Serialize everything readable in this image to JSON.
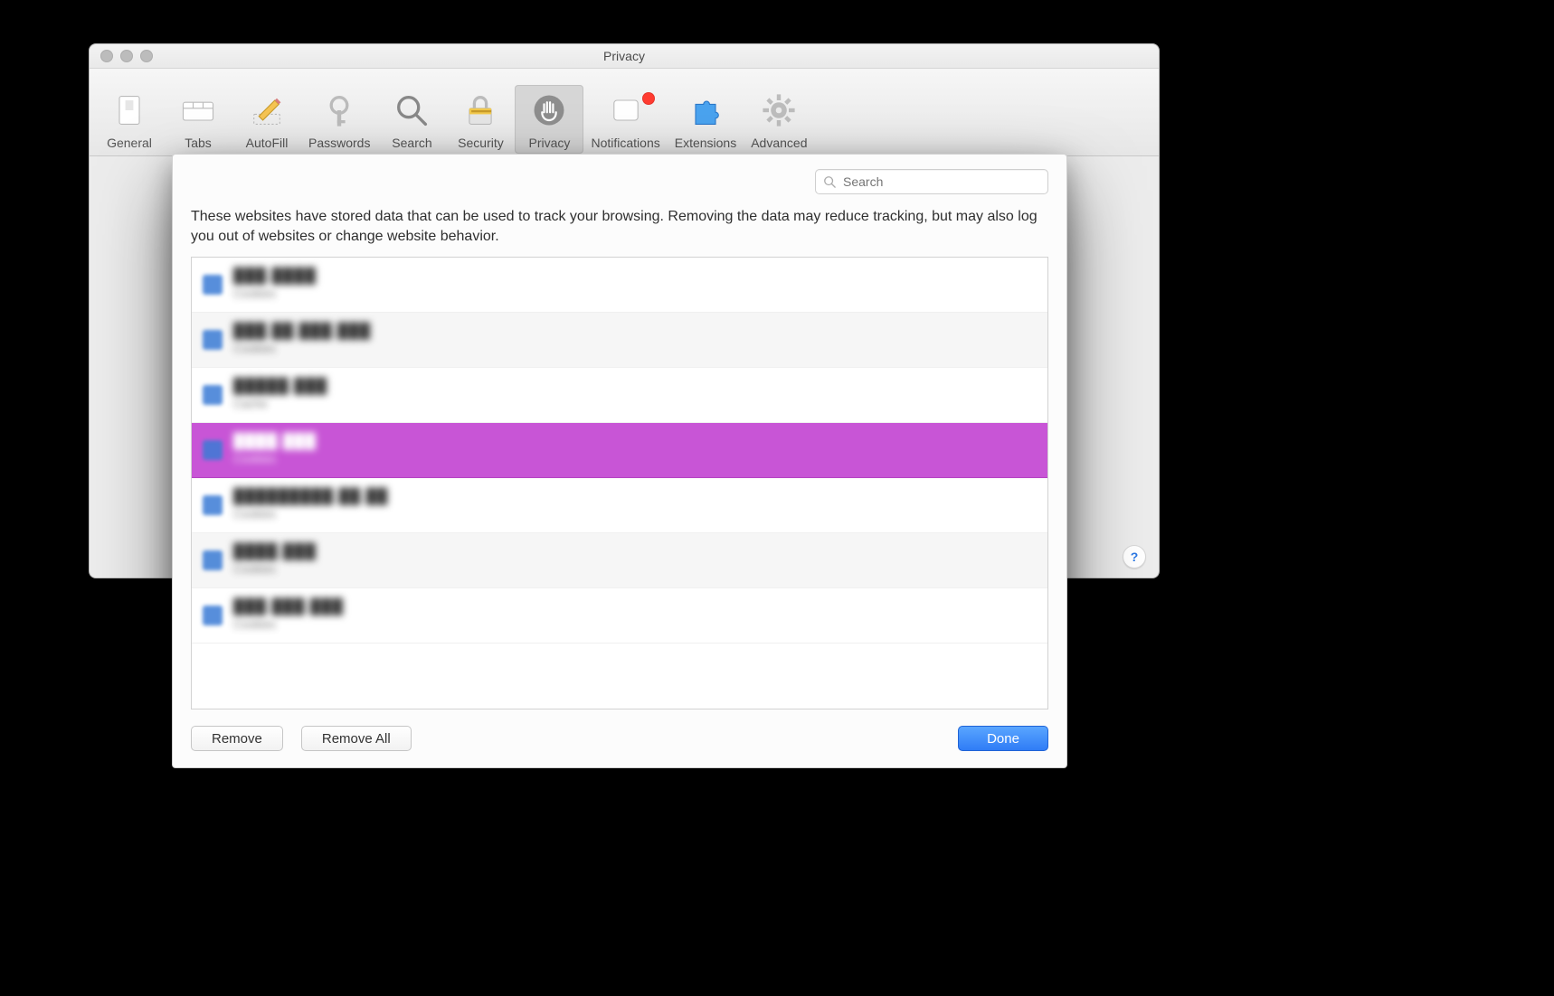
{
  "window": {
    "title": "Privacy"
  },
  "toolbar": {
    "items": [
      {
        "id": "general",
        "label": "General"
      },
      {
        "id": "tabs",
        "label": "Tabs"
      },
      {
        "id": "autofill",
        "label": "AutoFill"
      },
      {
        "id": "passwords",
        "label": "Passwords"
      },
      {
        "id": "search",
        "label": "Search"
      },
      {
        "id": "security",
        "label": "Security"
      },
      {
        "id": "privacy",
        "label": "Privacy",
        "selected": true
      },
      {
        "id": "notifications",
        "label": "Notifications",
        "has_badge": true
      },
      {
        "id": "extensions",
        "label": "Extensions"
      },
      {
        "id": "advanced",
        "label": "Advanced"
      }
    ]
  },
  "help_button": "?",
  "sheet": {
    "search_placeholder": "Search",
    "description": "These websites have stored data that can be used to track your browsing. Removing the data may reduce tracking, but may also log you out of websites or change website behavior.",
    "items": [
      {
        "domain": "███.████",
        "type": "Cookies",
        "selected": false,
        "obscured": true
      },
      {
        "domain": "███.██.███.███",
        "type": "Cookies",
        "selected": false,
        "obscured": true
      },
      {
        "domain": "█████.███",
        "type": "Cache",
        "selected": false,
        "obscured": true
      },
      {
        "domain": "████.███",
        "type": "Cookies",
        "selected": true,
        "obscured": true
      },
      {
        "domain": "█████████.██.██",
        "type": "Cookies",
        "selected": false,
        "obscured": true
      },
      {
        "domain": "████.███",
        "type": "Cookies",
        "selected": false,
        "obscured": true
      },
      {
        "domain": "███.███.███",
        "type": "Cookies",
        "selected": false,
        "obscured": true
      }
    ],
    "buttons": {
      "remove": "Remove",
      "remove_all": "Remove All",
      "done": "Done"
    }
  },
  "colors": {
    "selection": "#c855d6",
    "primary_button": "#2f7cf6"
  }
}
